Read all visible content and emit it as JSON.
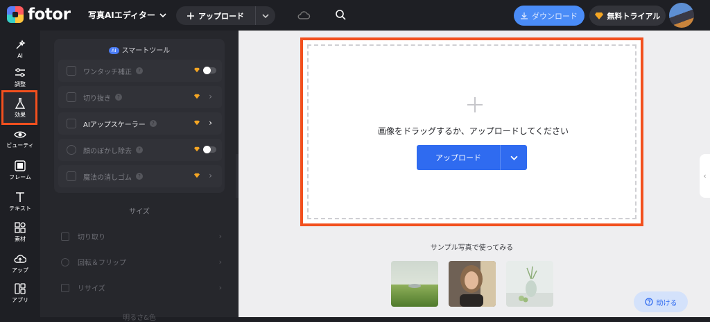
{
  "header": {
    "brand": "fotor",
    "editor_label": "写真AIエディター",
    "upload_label": "アップロード",
    "download_label": "ダウンロード",
    "trial_label": "無料トライアル"
  },
  "rail": {
    "items": [
      {
        "label": "AI",
        "icon": "magic-wand-icon"
      },
      {
        "label": "調整",
        "icon": "sliders-icon"
      },
      {
        "label": "効果",
        "icon": "flask-icon"
      },
      {
        "label": "ビューティ",
        "icon": "eye-icon"
      },
      {
        "label": "フレーム",
        "icon": "frame-icon"
      },
      {
        "label": "テキスト",
        "icon": "text-icon"
      },
      {
        "label": "素材",
        "icon": "shapes-icon"
      },
      {
        "label": "アップ",
        "icon": "cloud-upload-icon"
      },
      {
        "label": "アプリ",
        "icon": "apps-icon"
      }
    ]
  },
  "panel": {
    "ai_badge": "AI",
    "smart_title": "スマートツール",
    "smart_tools": [
      {
        "label": "ワンタッチ補正",
        "help": "?"
      },
      {
        "label": "切り抜き",
        "help": "?"
      },
      {
        "label": "AIアップスケーラー",
        "help": "?"
      },
      {
        "label": "顔のぼかし除去",
        "help": "?"
      },
      {
        "label": "魔法の消しゴム",
        "help": "?"
      }
    ],
    "size_title": "サイズ",
    "size_items": [
      {
        "label": "切り取り"
      },
      {
        "label": "回転＆フリップ"
      },
      {
        "label": "リサイズ"
      }
    ],
    "cut_section": "明るさ&色"
  },
  "canvas": {
    "drop_text": "画像をドラッグするか、アップロードしてください",
    "upload_button": "アップロード",
    "sample_title": "サンプル写真で使ってみる",
    "help_label": "助ける"
  },
  "colors": {
    "accent": "#2f6bf0",
    "highlight": "#f2501e",
    "premium": "#f5a623"
  }
}
